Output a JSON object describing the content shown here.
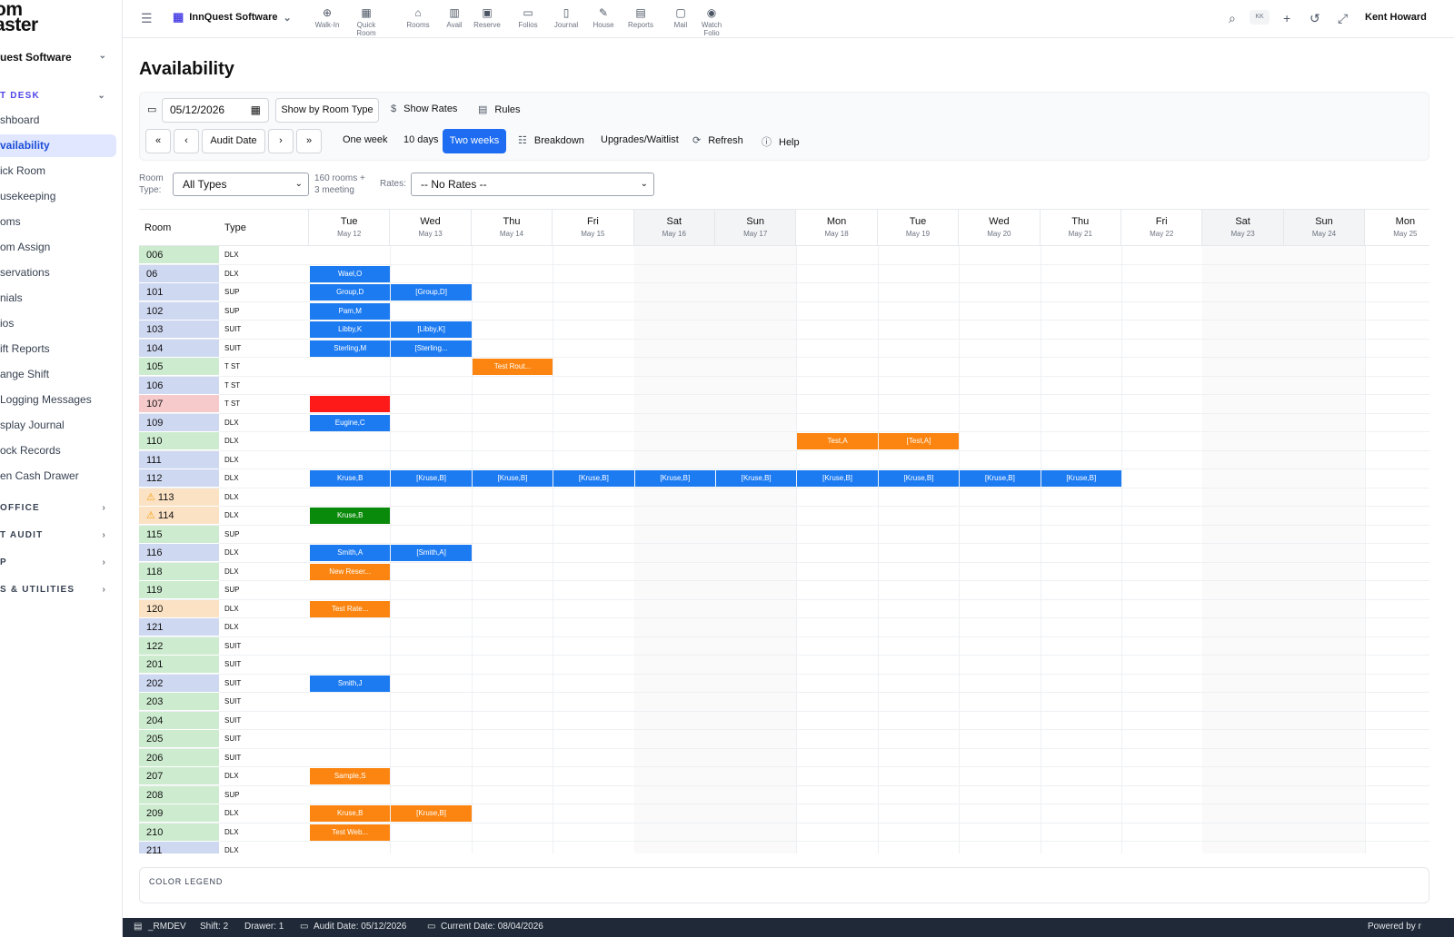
{
  "sidebar": {
    "logo_line1": "om",
    "logo_line2": "aster",
    "property": "uest Software",
    "sections": {
      "front_desk": "T DESK",
      "back_office": " OFFICE",
      "night_audit": "T AUDIT",
      "p": "P",
      "tools": "S & UTILITIES"
    },
    "items": [
      "shboard",
      "vailability",
      "ick Room",
      "usekeeping",
      "oms",
      "om Assign",
      "servations",
      "nials",
      "ios",
      "ift Reports",
      "ange Shift",
      "Logging Messages",
      "splay Journal",
      "ock Records",
      "en Cash Drawer"
    ]
  },
  "topbar": {
    "property": "InnQuest Software",
    "tools": [
      "Walk-In",
      "Quick Room",
      "Rooms",
      "Avail",
      "Reserve",
      "Folios",
      "Journal",
      "House",
      "Reports",
      "Mail",
      "Watch Folio"
    ],
    "kbd": "KK",
    "user": "Kent Howard"
  },
  "page": {
    "title": "Availability",
    "date": "05/12/2026",
    "show_by": "Show by Room Type",
    "show_rates": "Show Rates",
    "rules": "Rules",
    "audit_date": "Audit Date",
    "one_week": "One week",
    "ten_days": "10 days",
    "two_weeks": "Two weeks",
    "breakdown": "Breakdown",
    "upgrades": "Upgrades/Waitlist",
    "refresh": "Refresh",
    "help": "Help",
    "room_type_label": "Room Type:",
    "room_type_value": "All Types",
    "room_count": "160 rooms + 3 meeting",
    "rates_label": "Rates:",
    "rates_value": "-- No Rates --",
    "col_room": "Room",
    "col_type": "Type",
    "legend_title": "COLOR LEGEND"
  },
  "days": [
    {
      "d": "Tue",
      "m": "May 12",
      "we": false
    },
    {
      "d": "Wed",
      "m": "May 13",
      "we": false
    },
    {
      "d": "Thu",
      "m": "May 14",
      "we": false
    },
    {
      "d": "Fri",
      "m": "May 15",
      "we": false
    },
    {
      "d": "Sat",
      "m": "May 16",
      "we": true
    },
    {
      "d": "Sun",
      "m": "May 17",
      "we": true
    },
    {
      "d": "Mon",
      "m": "May 18",
      "we": false
    },
    {
      "d": "Tue",
      "m": "May 19",
      "we": false
    },
    {
      "d": "Wed",
      "m": "May 20",
      "we": false
    },
    {
      "d": "Thu",
      "m": "May 21",
      "we": false
    },
    {
      "d": "Fri",
      "m": "May 22",
      "we": false
    },
    {
      "d": "Sat",
      "m": "May 23",
      "we": true
    },
    {
      "d": "Sun",
      "m": "May 24",
      "we": true
    },
    {
      "d": "Mon",
      "m": "May 25",
      "we": false
    }
  ],
  "colors": {
    "clean": "#cdeccf",
    "dirty": "#cfd8f1",
    "ooo": "#f6caca",
    "inspect": "#fbe2c4",
    "blue": "#1d7bf2",
    "orange": "#fb8510",
    "red": "#ff1a1a",
    "green": "#0a8a0a"
  },
  "rooms": [
    {
      "n": "006",
      "t": "DLX",
      "s": "clean"
    },
    {
      "n": "06",
      "t": "DLX",
      "s": "dirty"
    },
    {
      "n": "101",
      "t": "SUP",
      "s": "dirty"
    },
    {
      "n": "102",
      "t": "SUP",
      "s": "dirty"
    },
    {
      "n": "103",
      "t": "SUIT",
      "s": "dirty"
    },
    {
      "n": "104",
      "t": "SUIT",
      "s": "dirty"
    },
    {
      "n": "105",
      "t": "T ST",
      "s": "clean"
    },
    {
      "n": "106",
      "t": "T ST",
      "s": "dirty"
    },
    {
      "n": "107",
      "t": "T ST",
      "s": "ooo"
    },
    {
      "n": "109",
      "t": "DLX",
      "s": "dirty"
    },
    {
      "n": "110",
      "t": "DLX",
      "s": "clean"
    },
    {
      "n": "111",
      "t": "DLX",
      "s": "dirty"
    },
    {
      "n": "112",
      "t": "DLX",
      "s": "dirty"
    },
    {
      "n": "113",
      "t": "DLX",
      "s": "inspect",
      "warn": true
    },
    {
      "n": "114",
      "t": "DLX",
      "s": "inspect",
      "warn": true
    },
    {
      "n": "115",
      "t": "SUP",
      "s": "clean"
    },
    {
      "n": "116",
      "t": "DLX",
      "s": "dirty"
    },
    {
      "n": "118",
      "t": "DLX",
      "s": "clean"
    },
    {
      "n": "119",
      "t": "SUP",
      "s": "clean"
    },
    {
      "n": "120",
      "t": "DLX",
      "s": "inspect"
    },
    {
      "n": "121",
      "t": "DLX",
      "s": "dirty"
    },
    {
      "n": "122",
      "t": "SUIT",
      "s": "clean"
    },
    {
      "n": "201",
      "t": "SUIT",
      "s": "clean"
    },
    {
      "n": "202",
      "t": "SUIT",
      "s": "dirty"
    },
    {
      "n": "203",
      "t": "SUIT",
      "s": "clean"
    },
    {
      "n": "204",
      "t": "SUIT",
      "s": "clean"
    },
    {
      "n": "205",
      "t": "SUIT",
      "s": "clean"
    },
    {
      "n": "206",
      "t": "SUIT",
      "s": "clean"
    },
    {
      "n": "207",
      "t": "DLX",
      "s": "clean"
    },
    {
      "n": "208",
      "t": "SUP",
      "s": "clean"
    },
    {
      "n": "209",
      "t": "DLX",
      "s": "clean"
    },
    {
      "n": "210",
      "t": "DLX",
      "s": "clean"
    },
    {
      "n": "211",
      "t": "DLX",
      "s": "dirty"
    }
  ],
  "bookings": [
    {
      "r": 1,
      "c": 0,
      "txt": "Wael,O",
      "col": "blue"
    },
    {
      "r": 2,
      "c": 0,
      "txt": "Group,D",
      "col": "blue"
    },
    {
      "r": 2,
      "c": 1,
      "txt": "[Group,D]",
      "col": "blue"
    },
    {
      "r": 3,
      "c": 0,
      "txt": "Pam,M",
      "col": "blue"
    },
    {
      "r": 4,
      "c": 0,
      "txt": "Libby,K",
      "col": "blue"
    },
    {
      "r": 4,
      "c": 1,
      "txt": "[Libby,K]",
      "col": "blue"
    },
    {
      "r": 5,
      "c": 0,
      "txt": "Sterling,M",
      "col": "blue"
    },
    {
      "r": 5,
      "c": 1,
      "txt": "[Sterling...",
      "col": "blue"
    },
    {
      "r": 6,
      "c": 2,
      "txt": "Test Rout...",
      "col": "orange"
    },
    {
      "r": 8,
      "c": 0,
      "txt": "",
      "col": "red"
    },
    {
      "r": 9,
      "c": 0,
      "txt": "Eugine,C",
      "col": "blue"
    },
    {
      "r": 10,
      "c": 6,
      "txt": "Test,A",
      "col": "orange"
    },
    {
      "r": 10,
      "c": 7,
      "txt": "[Test,A]",
      "col": "orange"
    },
    {
      "r": 12,
      "c": 0,
      "txt": "Kruse,B",
      "col": "blue"
    },
    {
      "r": 12,
      "c": 1,
      "txt": "[Kruse,B]",
      "col": "blue"
    },
    {
      "r": 12,
      "c": 2,
      "txt": "[Kruse,B]",
      "col": "blue"
    },
    {
      "r": 12,
      "c": 3,
      "txt": "[Kruse,B]",
      "col": "blue"
    },
    {
      "r": 12,
      "c": 4,
      "txt": "[Kruse,B]",
      "col": "blue"
    },
    {
      "r": 12,
      "c": 5,
      "txt": "[Kruse,B]",
      "col": "blue"
    },
    {
      "r": 12,
      "c": 6,
      "txt": "[Kruse,B]",
      "col": "blue"
    },
    {
      "r": 12,
      "c": 7,
      "txt": "[Kruse,B]",
      "col": "blue"
    },
    {
      "r": 12,
      "c": 8,
      "txt": "[Kruse,B]",
      "col": "blue"
    },
    {
      "r": 12,
      "c": 9,
      "txt": "[Kruse,B]",
      "col": "blue"
    },
    {
      "r": 14,
      "c": 0,
      "txt": "Kruse,B",
      "col": "green"
    },
    {
      "r": 16,
      "c": 0,
      "txt": "Smith,A",
      "col": "blue"
    },
    {
      "r": 16,
      "c": 1,
      "txt": "[Smith,A]",
      "col": "blue"
    },
    {
      "r": 17,
      "c": 0,
      "txt": "New Reser...",
      "col": "orange"
    },
    {
      "r": 19,
      "c": 0,
      "txt": "Test Rate...",
      "col": "orange"
    },
    {
      "r": 23,
      "c": 0,
      "txt": "Smith,J",
      "col": "blue"
    },
    {
      "r": 28,
      "c": 0,
      "txt": "Sample,S",
      "col": "orange"
    },
    {
      "r": 30,
      "c": 0,
      "txt": "Kruse,B",
      "col": "orange"
    },
    {
      "r": 30,
      "c": 1,
      "txt": "[Kruse,B]",
      "col": "orange"
    },
    {
      "r": 31,
      "c": 0,
      "txt": "Test Web...",
      "col": "orange"
    }
  ],
  "status": {
    "db": "_RMDEV",
    "shift": "Shift: 2",
    "drawer": "Drawer: 1",
    "audit": "Audit Date: 05/12/2026",
    "current": "Current Date: 08/04/2026",
    "powered": "Powered by r"
  }
}
